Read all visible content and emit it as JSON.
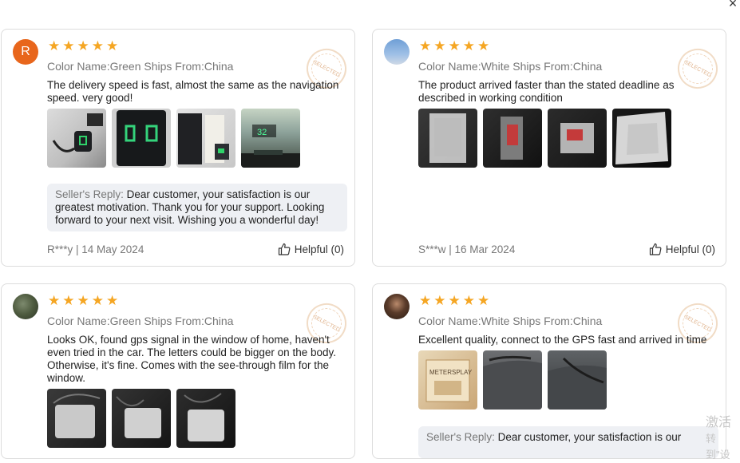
{
  "close": {
    "glyph": "×"
  },
  "star_glyph": "★",
  "seal_text": "SELECTED",
  "reviews": [
    {
      "avatar_letter": "R",
      "meta": "Color Name:Green Ships From:China",
      "text": "The delivery speed is fast, almost the same as the navigation speed. very good!",
      "photos": [
        "photo-1",
        "photo-2",
        "photo-3",
        "photo-4"
      ],
      "reply_label": "Seller's Reply: ",
      "reply_text": "Dear customer, your satisfaction is our greatest motivation. Thank you for your support. Looking forward to your next visit. Wishing you a wonderful day!",
      "author_date": "R***y | 14 May 2024",
      "helpful": "Helpful (0)"
    },
    {
      "avatar_letter": "",
      "meta": "Color Name:White Ships From:China",
      "text": "The product arrived faster than the stated deadline as described in working condition",
      "photos": [
        "photo-1",
        "photo-2",
        "photo-3",
        "photo-4"
      ],
      "author_date": "S***w | 16 Mar 2024",
      "helpful": "Helpful (0)"
    },
    {
      "avatar_letter": "",
      "meta": "Color Name:Green Ships From:China",
      "text": "Looks OK, found gps signal in the window of home, haven't even tried in the car. The letters could be bigger on the body. Otherwise, it's fine. Comes with the see-through film for the window.",
      "photos": [
        "photo-1",
        "photo-2",
        "photo-3"
      ]
    },
    {
      "avatar_letter": "",
      "meta": "Color Name:White Ships From:China",
      "text": "Excellent quality, connect to the GPS fast and arrived in time",
      "photos": [
        "photo-1",
        "photo-2",
        "photo-3"
      ],
      "reply_label": "Seller's Reply: ",
      "reply_text": "Dear customer, your satisfaction is our"
    }
  ],
  "photo_labels": {
    "hud_speed": "32",
    "box_brand": "METERSPLAY"
  },
  "watermark": {
    "line1": "激活",
    "line2": "转到\"设"
  }
}
